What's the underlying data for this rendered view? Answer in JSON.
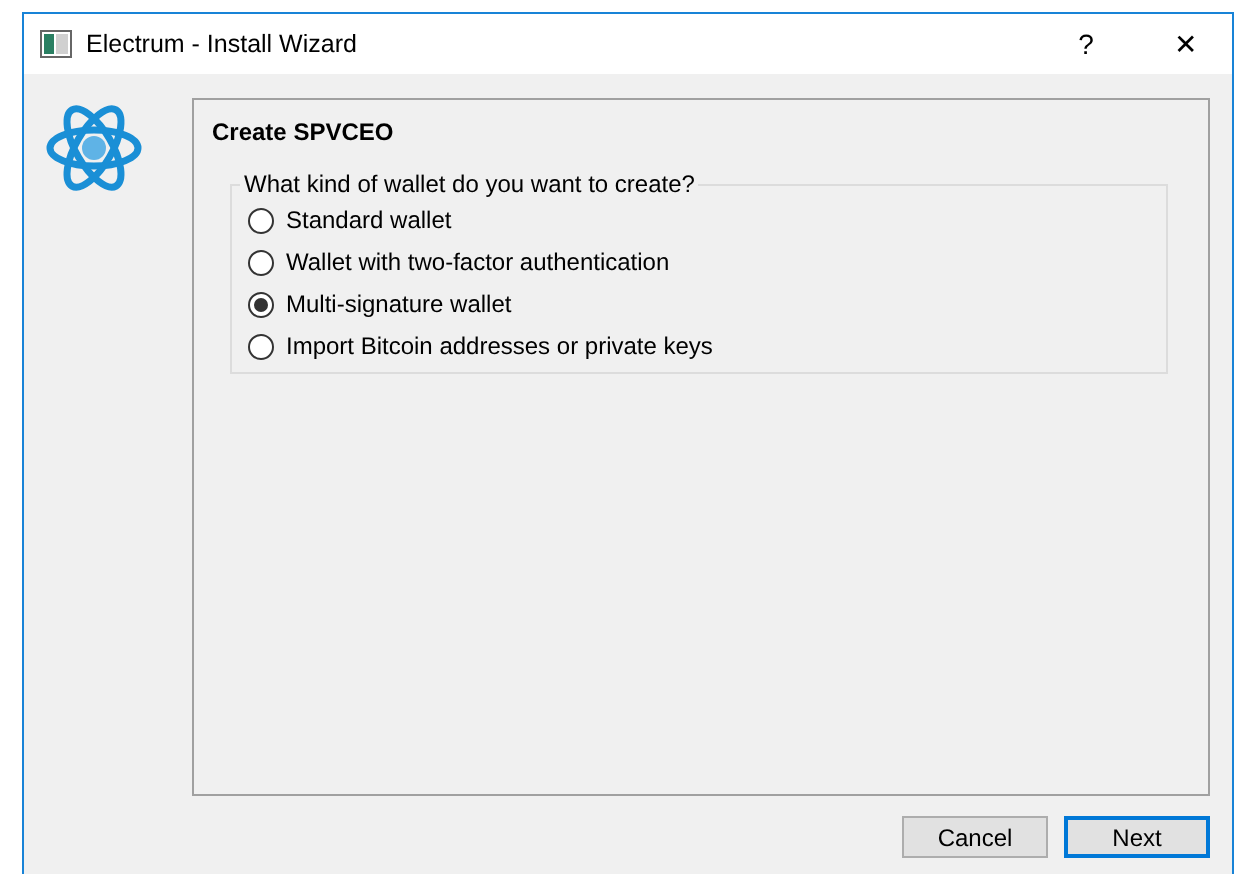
{
  "window": {
    "title": "Electrum  -  Install Wizard",
    "help": "?",
    "close": "✕"
  },
  "page": {
    "heading": "Create SPVCEO"
  },
  "group": {
    "legend": "What kind of wallet do you want to create?",
    "options": [
      {
        "label": "Standard wallet",
        "selected": false
      },
      {
        "label": "Wallet with two-factor authentication",
        "selected": false
      },
      {
        "label": "Multi-signature wallet",
        "selected": true
      },
      {
        "label": "Import Bitcoin addresses or private keys",
        "selected": false
      }
    ]
  },
  "buttons": [
    {
      "label": "Cancel",
      "default": false
    },
    {
      "label": "Next",
      "default": true
    }
  ]
}
